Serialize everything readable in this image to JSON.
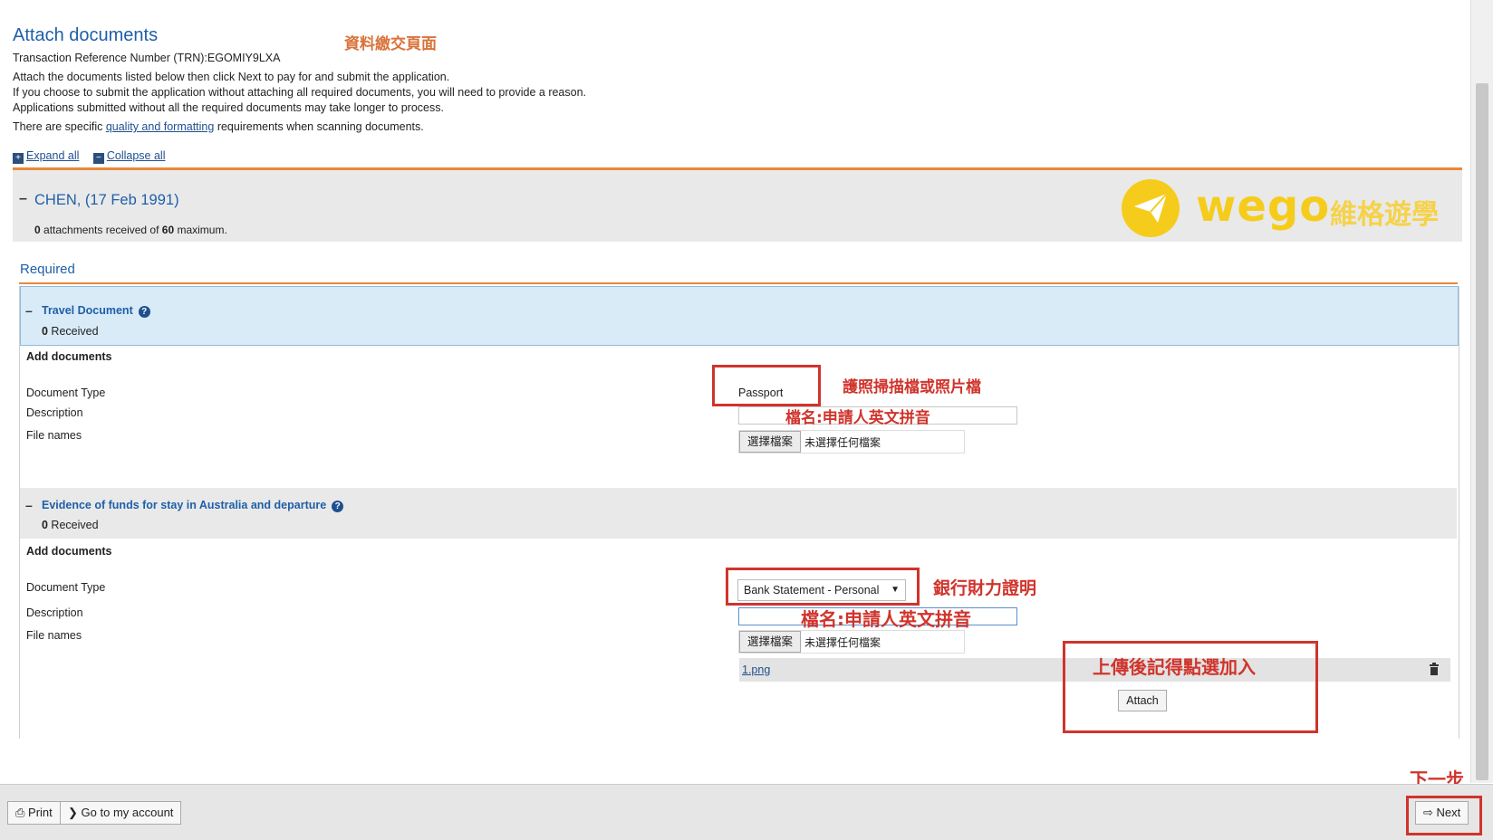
{
  "header": {
    "title": "Attach documents",
    "title_annotation": "資料繳交頁面",
    "trn": "Transaction Reference Number (TRN):EGOMIY9LXA",
    "intro_lines": [
      "Attach the documents listed below then click Next to pay for and submit the application.",
      "If you choose to submit the application without attaching all required documents, you will need to provide a reason.",
      "Applications submitted without all the required documents may take longer to process."
    ],
    "specific_prefix": "There are specific ",
    "specific_link": "quality and formatting",
    "specific_suffix": " requirements when scanning documents.",
    "expand_all": "Expand all",
    "collapse_all": "Collapse all"
  },
  "applicant": {
    "name": "CHEN, (17 Feb 1991)",
    "received_count": "0",
    "received_mid": " attachments received of ",
    "max_count": "60",
    "received_suffix": " maximum."
  },
  "watermark": {
    "brand": "wego",
    "brand_cn": "維格遊學",
    "brand_color": "#f6cc1c"
  },
  "required_label": "Required",
  "sections": [
    {
      "title": "Travel Document",
      "received_count": "0",
      "received_label": " Received",
      "add_documents": "Add documents",
      "labels": {
        "type": "Document Type",
        "description": "Description",
        "file_names": "File names"
      },
      "doc_type_value": "Passport",
      "type_annotation": "護照掃描檔或照片檔",
      "desc_annotation": "檔名:申請人英文拼音",
      "choose_file": "選擇檔案",
      "no_file": "未選擇任何檔案"
    },
    {
      "title": "Evidence of funds for stay in Australia and departure",
      "received_count": "0",
      "received_label": " Received",
      "add_documents": "Add documents",
      "labels": {
        "type": "Document Type",
        "description": "Description",
        "file_names": "File names"
      },
      "doc_type_value": "Bank Statement - Personal",
      "type_annotation": "銀行財力證明",
      "desc_annotation": "檔名:申請人英文拼音",
      "choose_file": "選擇檔案",
      "no_file": "未選擇任何檔案",
      "uploaded_file": "1.png",
      "attach_annotation": "上傳後記得點選加入",
      "attach_button": "Attach"
    }
  ],
  "footer": {
    "print": "Print",
    "go_account": "Go to my account",
    "next": "Next",
    "next_annotation": "下一步"
  },
  "colors": {
    "annotation_red": "#d0342c",
    "link_blue": "#1f5fa8",
    "accent_orange": "#e8883a"
  }
}
